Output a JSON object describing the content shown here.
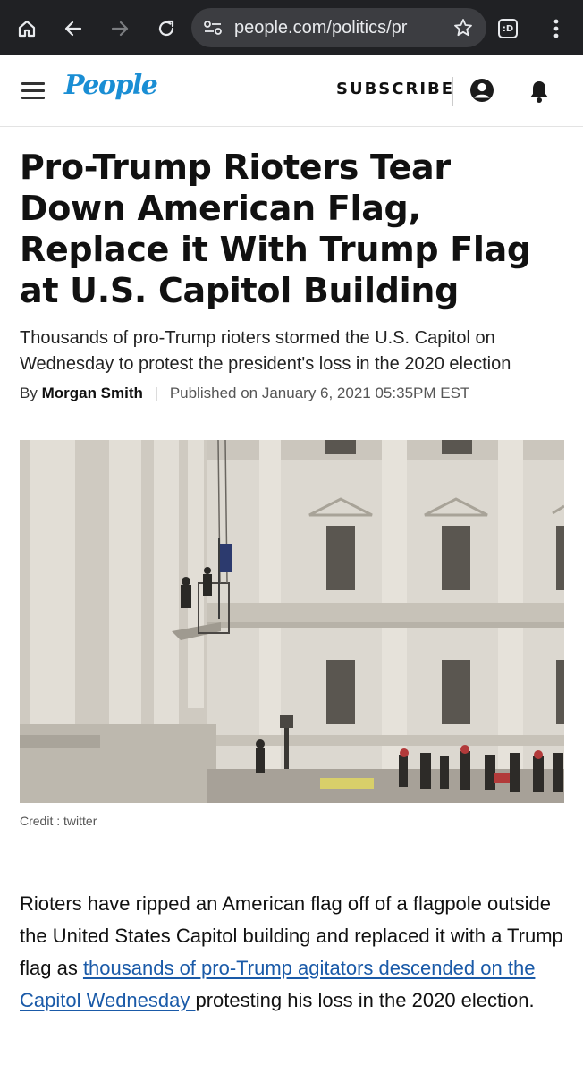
{
  "browser": {
    "url": "people.com/politics/pr",
    "icons": [
      "home-icon",
      "back-arrow-icon",
      "forward-arrow-icon",
      "reload-icon",
      "site-settings-icon",
      "bookmark-star-icon",
      "tab-switcher-icon",
      "more-menu-icon"
    ],
    "tab_count_label": ":D"
  },
  "header": {
    "logo": "People",
    "subscribe_label": "SUBSCRIBE",
    "icons": [
      "menu-icon",
      "account-icon",
      "notifications-bell-icon"
    ],
    "brand_color": "#1a8ed4"
  },
  "article": {
    "headline": "Pro-Trump Rioters Tear Down American Flag, Replace it With Trump Flag at U.S. Capitol Building",
    "dek": "Thousands of pro-Trump rioters stormed the U.S. Capitol on Wednesday to protest the president's loss in the 2020 election",
    "byline_prefix": "By",
    "author": "Morgan Smith",
    "separator": "|",
    "published": "Published on January 6, 2021 05:35PM EST",
    "photo_credit": "Credit : twitter",
    "body_before_link": "Rioters have ripped an American flag off of a flagpole outside the United States Capitol building and replaced it with a Trump flag as ",
    "body_link": "thousands of pro-Trump agitators descended on the Capitol Wednesday ",
    "body_after_link": "protesting his loss in the 2020 election.",
    "link_color": "#1a5aa8"
  }
}
